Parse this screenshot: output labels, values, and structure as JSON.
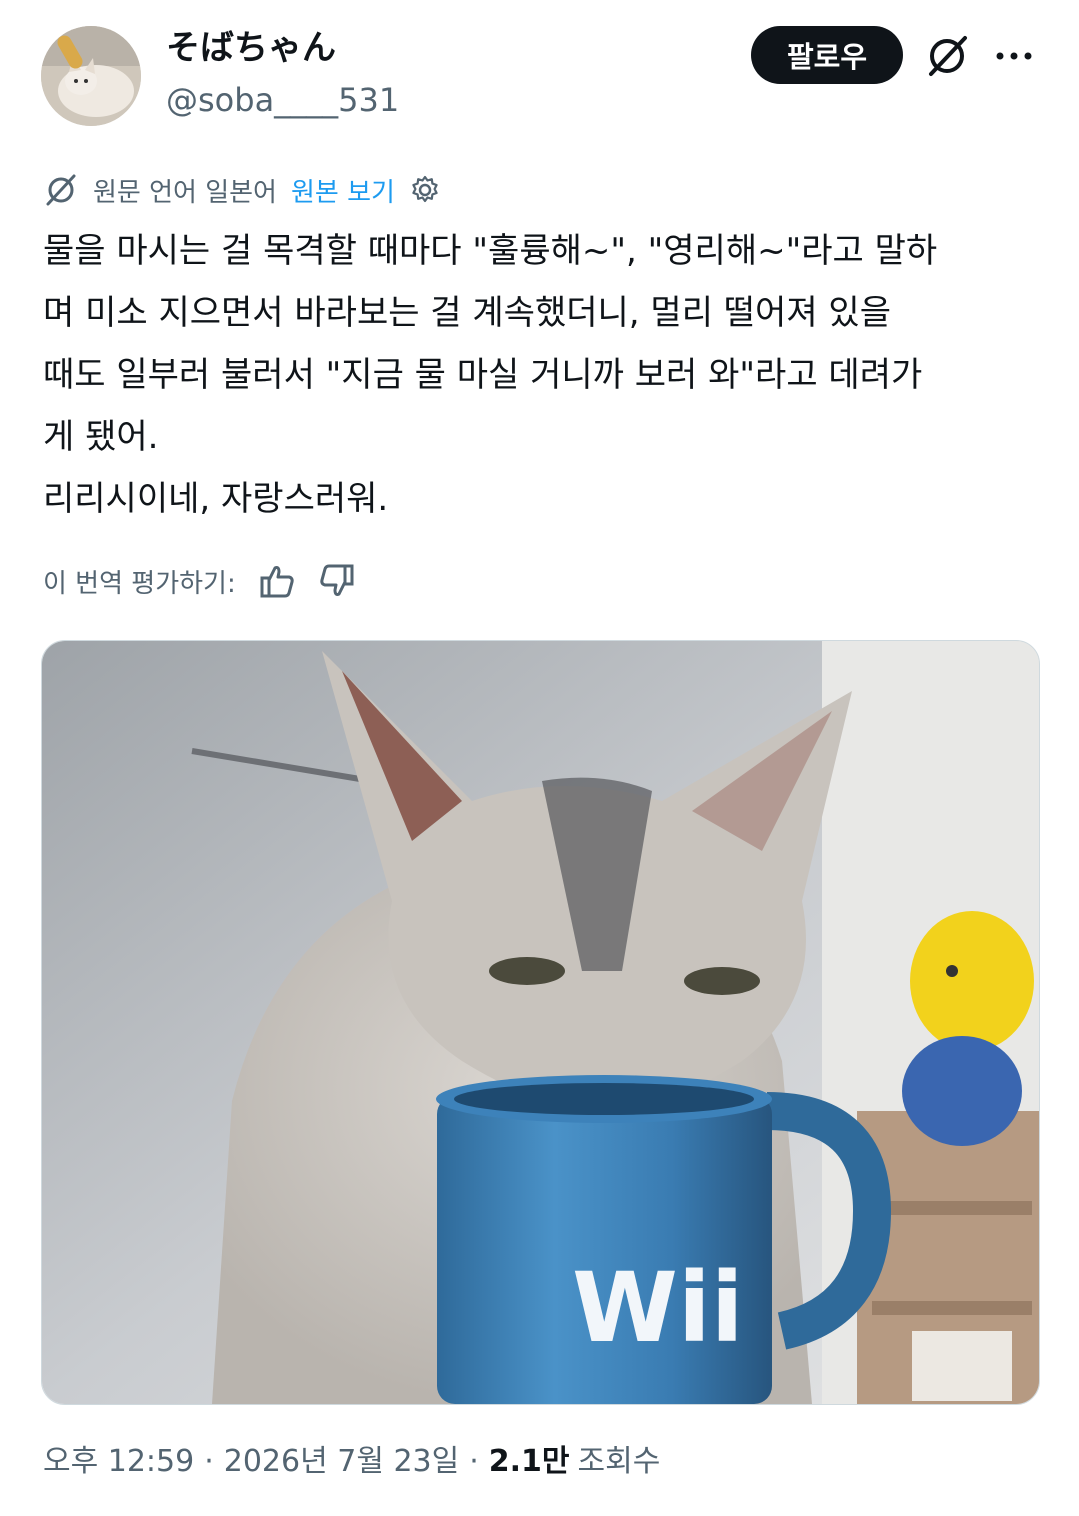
{
  "author": {
    "display_name": "そばちゃん",
    "handle": "@soba____531"
  },
  "header": {
    "follow_label": "팔로우"
  },
  "translation": {
    "prefix": "원문 언어 일본어",
    "show_original": "원본 보기"
  },
  "post": {
    "text": "물을 마시는 걸 목격할 때마다 \"훌륭해~\", \"영리해~\"라고 말하\n며 미소 지으면서 바라보는 걸 계속했더니, 멀리 떨어져 있을\n때도 일부러 불러서 \"지금 물 마실 거니까 보러 와\"라고 데려가\n게 됐어.\n리리시이네, 자랑스러워."
  },
  "rating": {
    "label": "이 번역 평가하기:"
  },
  "media": {
    "mug_text": "Wii"
  },
  "meta": {
    "time": "오후 12:59",
    "date": "2026년 7월 23일",
    "views_count": "2.1만",
    "views_label": "조회수"
  },
  "colors": {
    "accent": "#1d9bf0",
    "text": "#0f1419",
    "secondary": "#536471"
  }
}
